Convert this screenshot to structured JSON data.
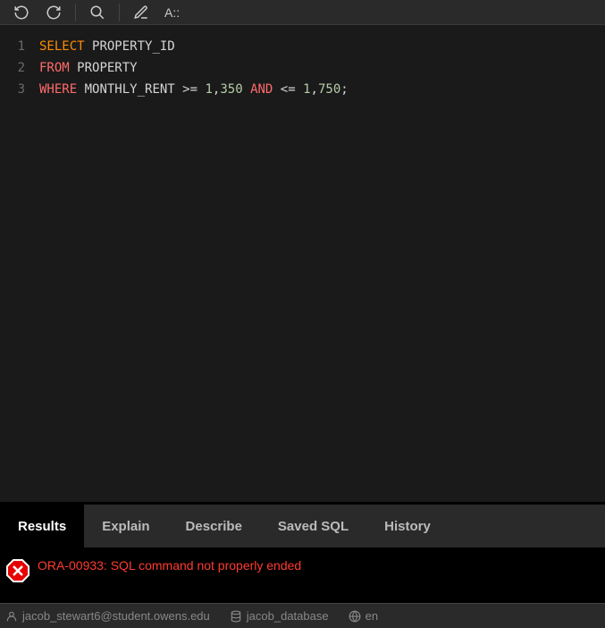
{
  "toolbar": {
    "font_size_label": "A::"
  },
  "editor": {
    "lines": [
      {
        "n": "1",
        "tokens": [
          {
            "t": "SELECT",
            "c": "kw-select"
          },
          {
            "t": " ",
            "c": ""
          },
          {
            "t": "PROPERTY_ID",
            "c": "ident"
          }
        ]
      },
      {
        "n": "2",
        "tokens": [
          {
            "t": "FROM",
            "c": "kw-from"
          },
          {
            "t": " ",
            "c": ""
          },
          {
            "t": "PROPERTY",
            "c": "ident"
          }
        ]
      },
      {
        "n": "3",
        "tokens": [
          {
            "t": "WHERE",
            "c": "kw-where"
          },
          {
            "t": " ",
            "c": ""
          },
          {
            "t": "MONTHLY_RENT",
            "c": "ident"
          },
          {
            "t": " >= ",
            "c": "op"
          },
          {
            "t": "1",
            "c": "num-part"
          },
          {
            "t": ",",
            "c": "op"
          },
          {
            "t": "350",
            "c": "num-part"
          },
          {
            "t": " ",
            "c": ""
          },
          {
            "t": "AND",
            "c": "kw-and"
          },
          {
            "t": " <= ",
            "c": "op"
          },
          {
            "t": "1",
            "c": "num-part"
          },
          {
            "t": ",",
            "c": "op"
          },
          {
            "t": "750",
            "c": "num-part"
          },
          {
            "t": ";",
            "c": "op"
          }
        ]
      }
    ]
  },
  "tabs": {
    "items": [
      {
        "label": "Results",
        "active": true
      },
      {
        "label": "Explain",
        "active": false
      },
      {
        "label": "Describe",
        "active": false
      },
      {
        "label": "Saved SQL",
        "active": false
      },
      {
        "label": "History",
        "active": false
      }
    ]
  },
  "error": {
    "message": "ORA-00933: SQL command not properly ended"
  },
  "statusbar": {
    "user": "jacob_stewart6@student.owens.edu",
    "database": "jacob_database",
    "language": "en"
  }
}
